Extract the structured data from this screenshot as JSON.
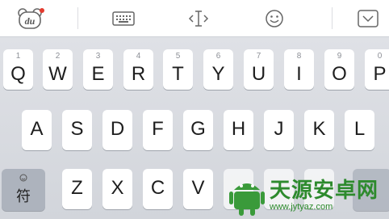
{
  "toolbar": {
    "logo_text": "du",
    "icons": [
      "du-bear-logo-icon",
      "keyboard-icon",
      "text-cursor-icon",
      "emoji-icon",
      "hide-keyboard-icon"
    ],
    "notification_dot_color": "#e33b2e"
  },
  "rows": [
    {
      "keys": [
        {
          "num": "1",
          "letter": "Q"
        },
        {
          "num": "2",
          "letter": "W"
        },
        {
          "num": "3",
          "letter": "E"
        },
        {
          "num": "4",
          "letter": "R"
        },
        {
          "num": "5",
          "letter": "T"
        },
        {
          "num": "6",
          "letter": "Y"
        },
        {
          "num": "7",
          "letter": "U"
        },
        {
          "num": "8",
          "letter": "I"
        },
        {
          "num": "9",
          "letter": "O"
        },
        {
          "num": "0",
          "letter": "P"
        }
      ]
    },
    {
      "keys": [
        {
          "letter": "A"
        },
        {
          "letter": "S"
        },
        {
          "letter": "D"
        },
        {
          "letter": "F"
        },
        {
          "letter": "G"
        },
        {
          "letter": "H"
        },
        {
          "letter": "J"
        },
        {
          "letter": "K"
        },
        {
          "letter": "L"
        }
      ]
    },
    {
      "keys": [
        {
          "letter": "符"
        },
        {
          "letter": "Z"
        },
        {
          "letter": "X"
        },
        {
          "letter": "C"
        },
        {
          "letter": "V"
        }
      ]
    }
  ],
  "watermark": {
    "name": "天源安卓网",
    "url": "www.jytyaz.com",
    "color": "#2d8a2d"
  }
}
